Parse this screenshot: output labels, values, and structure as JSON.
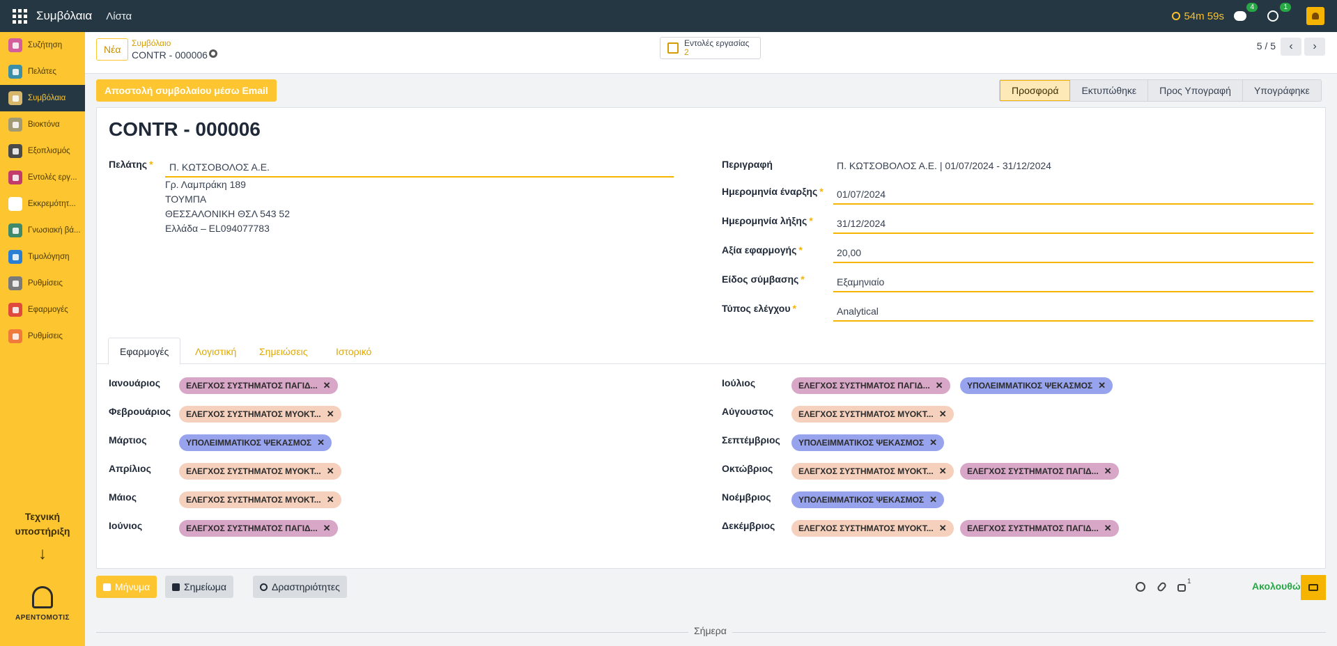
{
  "navbar": {
    "app_title": "Συμβόλαια",
    "menu_list": "Λίστα",
    "timer": "54m 59s",
    "messages_badge": "4",
    "activities_badge": "1"
  },
  "sidebar": {
    "items": [
      {
        "label": "Συζήτηση",
        "icon": "chat-icon",
        "color": "#d45d9c"
      },
      {
        "label": "Πελάτες",
        "icon": "users-icon",
        "color": "#3b8fa8"
      },
      {
        "label": "Συμβόλαια",
        "icon": "contract-icon",
        "color": "#d7b86a"
      },
      {
        "label": "Βιοκτόνα",
        "icon": "biocide-icon",
        "color": "#a29a73"
      },
      {
        "label": "Εξοπλισμός",
        "icon": "equipment-icon",
        "color": "#4a4a4a"
      },
      {
        "label": "Εντολές εργ...",
        "icon": "work-order-icon",
        "color": "#c13b6b"
      },
      {
        "label": "Εκκρεμότητ...",
        "icon": "pending-icon",
        "color": "#ffffff"
      },
      {
        "label": "Γνωσιακή βά...",
        "icon": "knowledge-icon",
        "color": "#3f8a6b"
      },
      {
        "label": "Τιμολόγηση",
        "icon": "invoice-icon",
        "color": "#2a7fd4"
      },
      {
        "label": "Ρυθμίσεις",
        "icon": "settings-icon",
        "color": "#7a7a7a"
      },
      {
        "label": "Εφαρμογές",
        "icon": "apps-icon",
        "color": "#e04a3c"
      },
      {
        "label": "Ρυθμίσεις",
        "icon": "settings-alt-icon",
        "color": "#f07a3c"
      }
    ],
    "support_line1": "Τεχνική",
    "support_line2": "υποστήριξη",
    "arrow": "↓",
    "logo_text": "ΑΡΕΝΤΟΜΟΤΙΣ"
  },
  "control": {
    "new_button": "Νέα",
    "breadcrumb_parent": "Συμβόλαιο",
    "breadcrumb_current": "CONTR - 000006",
    "work_orders_label": "Εντολές εργασίας",
    "work_orders_count": "2",
    "pager": "5 / 5"
  },
  "statusbar": {
    "email_button": "Αποστολή συμβολαίου μέσω Email",
    "stages": [
      "Προσφορά",
      "Εκτυπώθηκε",
      "Προς Υπογραφή",
      "Υπογράφηκε"
    ],
    "current_stage": "Προσφορά"
  },
  "form": {
    "title": "CONTR - 000006",
    "customer_label": "Πελάτης",
    "customer_value": "Π. ΚΩΤΣΟΒΟΛΟΣ Α.Ε.",
    "address": [
      "Γρ. Λαμπράκη 189",
      "ΤΟΥΜΠΑ",
      "ΘΕΣΣΑΛΟΝΙΚΗ ΘΣΛ 543 52",
      "Ελλάδα – EL094077783"
    ],
    "description_label": "Περιγραφή",
    "description_value": "Π. ΚΩΤΣΟΒΟΛΟΣ Α.Ε. | 01/07/2024 - 31/12/2024",
    "start_label": "Ημερομηνία έναρξης",
    "start_value": "01/07/2024",
    "end_label": "Ημερομηνία λήξης",
    "end_value": "31/12/2024",
    "value_label": "Αξία εφαρμογής",
    "value_value": "20,00",
    "type_label": "Είδος σύμβασης",
    "type_value": "Εξαμηνιαίο",
    "control_label": "Τύπος ελέγχου",
    "control_value": "Analytical",
    "required_mark": "*"
  },
  "tabs": [
    "Εφαρμογές",
    "Λογιστική",
    "Σημειώσεις",
    "Ιστορικό"
  ],
  "tags": {
    "pagides": "ΕΛΕΓΧΟΣ ΣΥΣΤΗΜΑΤΟΣ ΠΑΓΙΔ...",
    "mykt": "ΕΛΕΓΧΟΣ ΣΥΣΤΗΜΑΤΟΣ ΜΥΟΚΤ...",
    "psekasmos": "ΥΠΟΛΕΙΜΜΑΤΙΚΟΣ ΨΕΚΑΣΜΟΣ",
    "remove": "✕"
  },
  "months": {
    "jan": "Ιανουάριος",
    "feb": "Φεβρουάριος",
    "mar": "Μάρτιος",
    "apr": "Απρίλιος",
    "may": "Μάιος",
    "jun": "Ιούνιος",
    "jul": "Ιούλιος",
    "aug": "Αύγουστος",
    "sep": "Σεπτέμβριος",
    "oct": "Οκτώβριος",
    "nov": "Νοέμβριος",
    "dec": "Δεκέμβριος"
  },
  "chatter": {
    "message_button": "Μήνυμα",
    "note_button": "Σημείωμα",
    "activities_button": "Δραστηριότητες",
    "followers_count": "1",
    "follow_label": "Ακολουθώ",
    "today": "Σήμερα"
  },
  "colors": {
    "brand": "#fdc530",
    "navbar": "#243742",
    "tag_pagides": "#d8a6c6",
    "tag_mykt": "#f5d0bd",
    "tag_psekasmos": "#97a3ec"
  }
}
